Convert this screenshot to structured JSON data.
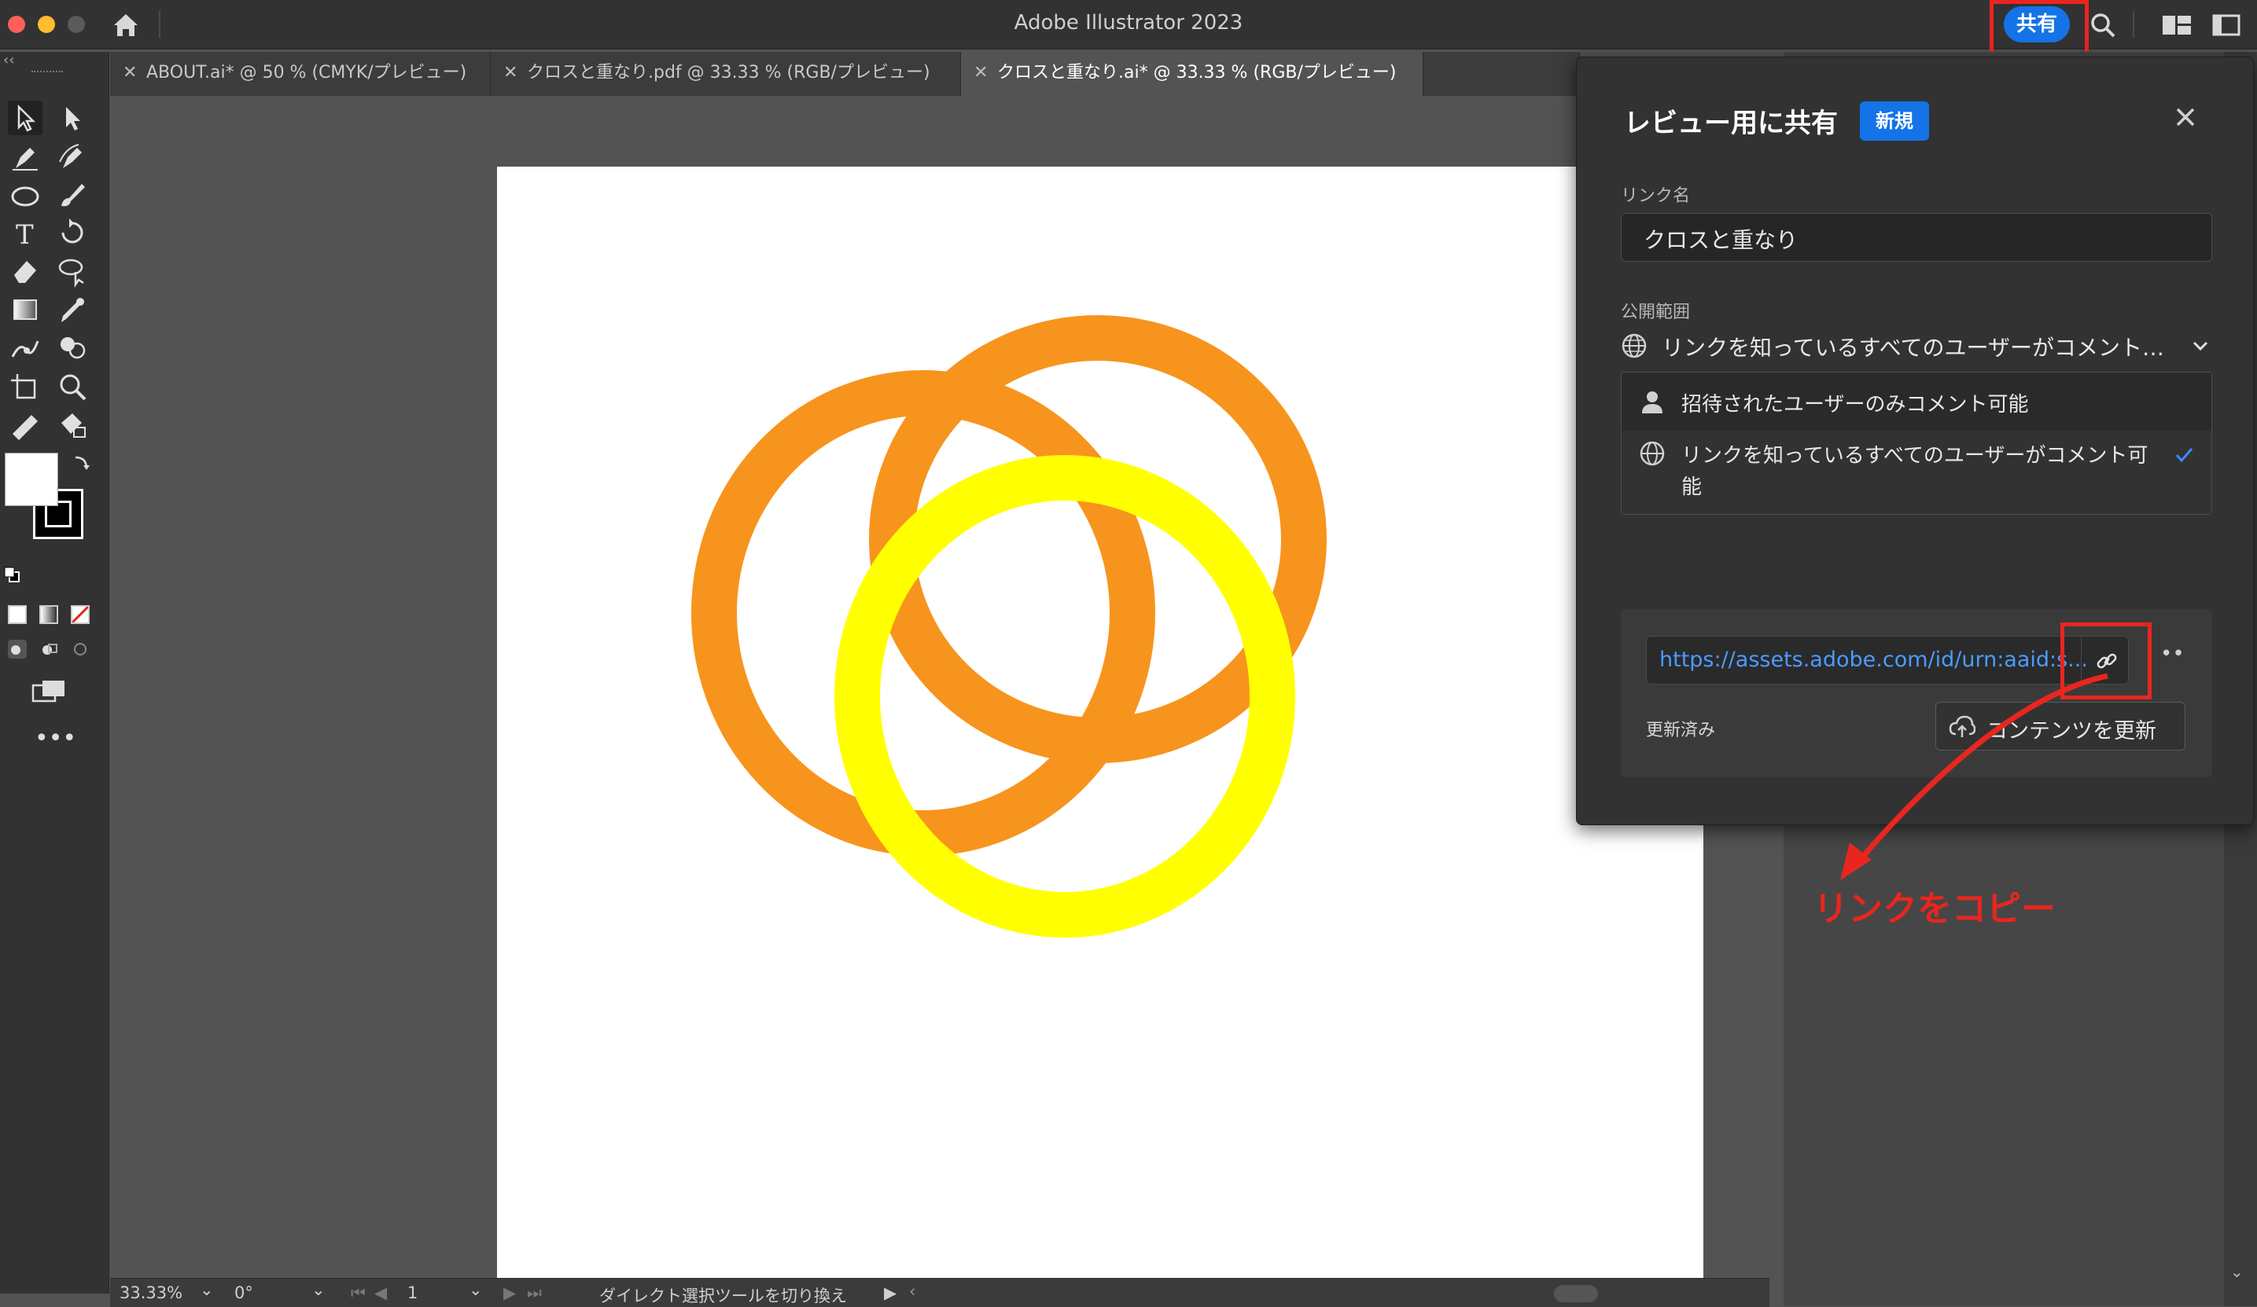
{
  "app": {
    "title": "Adobe Illustrator 2023",
    "share_label": "共有"
  },
  "tabs": [
    {
      "label": "ABOUT.ai* @ 50 % (CMYK/プレビュー)",
      "active": false
    },
    {
      "label": "クロスと重なり.pdf @ 33.33 % (RGB/プレビュー)",
      "active": false
    },
    {
      "label": "クロスと重なり.ai* @ 33.33 % (RGB/プレビュー)",
      "active": true
    }
  ],
  "status": {
    "zoom": "33.33%",
    "rotation": "0°",
    "artboard": "1",
    "tool_hint": "ダイレクト選択ツールを切り換え"
  },
  "share_panel": {
    "title": "レビュー用に共有",
    "badge": "新規",
    "link_name_label": "リンク名",
    "link_name_value": "クロスと重なり",
    "access_label": "公開範囲",
    "access_selected": "リンクを知っているすべてのユーザーがコメント…",
    "access_options": [
      {
        "label": "招待されたユーザーのみコメント可能",
        "icon": "user-icon",
        "selected": false
      },
      {
        "label": "リンクを知っているすべてのユーザーがコメント可能",
        "icon": "globe-icon",
        "selected": true
      }
    ],
    "url": "https://assets.adobe.com/id/urn:aaid:s...",
    "updated_label": "更新済み",
    "update_button": "コンテンツを更新"
  },
  "annotation": {
    "text": "リンクをコピー",
    "color": "#e8261f"
  },
  "artwork": {
    "ring_colors": [
      "#f7941d",
      "#f7941d",
      "#ffff00"
    ]
  }
}
